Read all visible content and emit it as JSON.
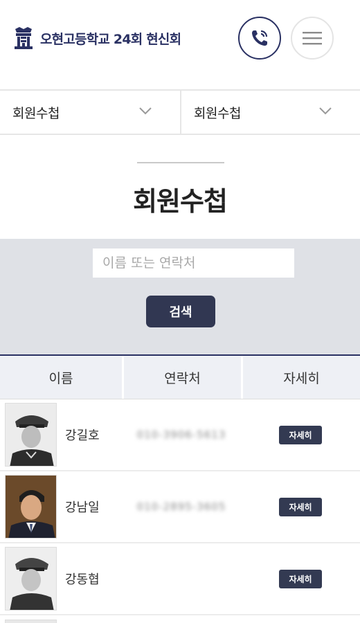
{
  "header": {
    "logo_text": "오현고등학교 24회 현신회",
    "call_icon": "phone-call-icon",
    "menu_icon": "hamburger-menu-icon",
    "brand_color": "#2a3163"
  },
  "dropdowns": [
    {
      "label": "회원수첩"
    },
    {
      "label": "회원수첩"
    }
  ],
  "page": {
    "title": "회원수첩"
  },
  "search": {
    "placeholder": "이름 또는 연락처",
    "value": "",
    "button_label": "검색"
  },
  "table": {
    "headers": [
      "이름",
      "연락처",
      "자세히"
    ],
    "rows": [
      {
        "name": "강길호",
        "phone": "010-3906-5613",
        "detail_label": "자세히",
        "photo": "uniform"
      },
      {
        "name": "강남일",
        "phone": "010-2895-3605",
        "detail_label": "자세히",
        "photo": "suit"
      },
      {
        "name": "강동협",
        "phone": "",
        "detail_label": "자세히",
        "photo": "uniform"
      }
    ]
  }
}
